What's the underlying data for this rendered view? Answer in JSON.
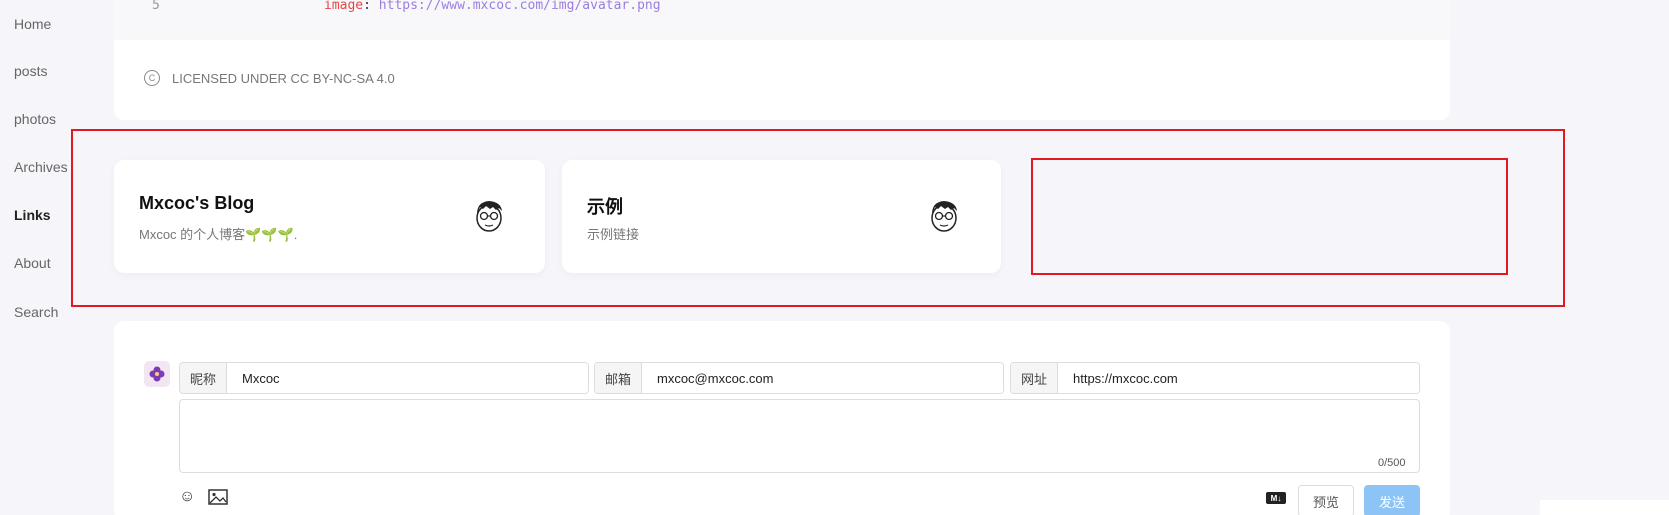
{
  "nav": {
    "items": [
      {
        "label": "Home"
      },
      {
        "label": "posts"
      },
      {
        "label": "photos"
      },
      {
        "label": "Archives"
      },
      {
        "label": "Links",
        "active": true
      },
      {
        "label": "About"
      },
      {
        "label": "Search"
      }
    ]
  },
  "article": {
    "code_line_number": "5",
    "code_key": "image",
    "code_value": "https://www.mxcoc.com/img/avatar.png",
    "license_text": "LICENSED UNDER CC BY-NC-SA 4.0"
  },
  "links": [
    {
      "title": "Mxcoc's Blog",
      "description": "Mxcoc 的个人博客🌱🌱🌱."
    },
    {
      "title": "示例",
      "description": "示例链接"
    }
  ],
  "comment": {
    "nick_label": "昵称",
    "nick_value": "Mxcoc",
    "email_label": "邮箱",
    "email_value": "mxcoc@mxcoc.com",
    "url_label": "网址",
    "url_value": "https://mxcoc.com",
    "counter": "0/500",
    "md_badge": "M↓",
    "preview_label": "预览",
    "send_label": "发送"
  },
  "colors": {
    "highlight_outline": "#e11a22",
    "send_button": "#8cc4f5"
  }
}
